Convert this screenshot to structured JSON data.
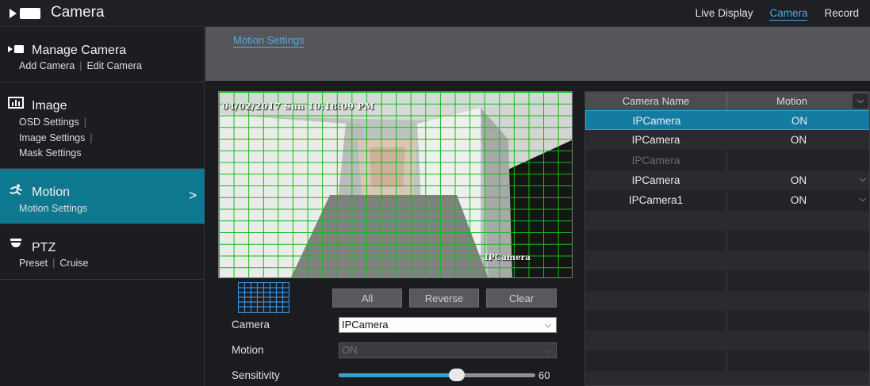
{
  "app": {
    "title": "Camera"
  },
  "top_nav": [
    {
      "label": "Live Display",
      "active": false
    },
    {
      "label": "Camera",
      "active": true
    },
    {
      "label": "Record",
      "active": false
    }
  ],
  "sidebar": {
    "sections": [
      {
        "title": "Manage Camera",
        "icon": "camera-icon",
        "items": [
          "Add Camera",
          "Edit Camera"
        ]
      },
      {
        "title": "Image",
        "icon": "image-settings-icon",
        "items": [
          "OSD Settings",
          "Image Settings",
          "Mask Settings"
        ]
      },
      {
        "title": "Motion",
        "icon": "running-person-icon",
        "items": [
          "Motion Settings"
        ],
        "active": true
      },
      {
        "title": "PTZ",
        "icon": "ptz-dome-icon",
        "items": [
          "Preset",
          "Cruise"
        ]
      }
    ],
    "active_chevron": ">"
  },
  "content": {
    "tab": "Motion Settings"
  },
  "video": {
    "timestamp": "04/02/2017 Sun 10:18:09 PM",
    "camera_label": "IPCamera"
  },
  "buttons": {
    "all": "All",
    "reverse": "Reverse",
    "clear": "Clear"
  },
  "form": {
    "camera_label": "Camera",
    "camera_value": "IPCamera",
    "motion_label": "Motion",
    "motion_value": "ON",
    "sensitivity_label": "Sensitivity",
    "sensitivity_value": "60",
    "sensitivity_level": 0.6
  },
  "table": {
    "headers": {
      "name": "Camera Name",
      "motion": "Motion"
    },
    "rows": [
      {
        "name": "IPCamera",
        "motion": "ON",
        "selected": true,
        "dropdown": false,
        "disabled": false
      },
      {
        "name": "IPCamera",
        "motion": "ON",
        "selected": false,
        "dropdown": false,
        "disabled": false
      },
      {
        "name": "IPCamera",
        "motion": "",
        "selected": false,
        "dropdown": false,
        "disabled": true
      },
      {
        "name": "IPCamera",
        "motion": "ON",
        "selected": false,
        "dropdown": true,
        "disabled": false
      },
      {
        "name": "IPCamera1",
        "motion": "ON",
        "selected": false,
        "dropdown": true,
        "disabled": false
      }
    ]
  },
  "colors": {
    "accent": "#0f7891",
    "link": "#4fa6e4",
    "grid": "#16b81a",
    "selected_row": "#147ca3"
  }
}
